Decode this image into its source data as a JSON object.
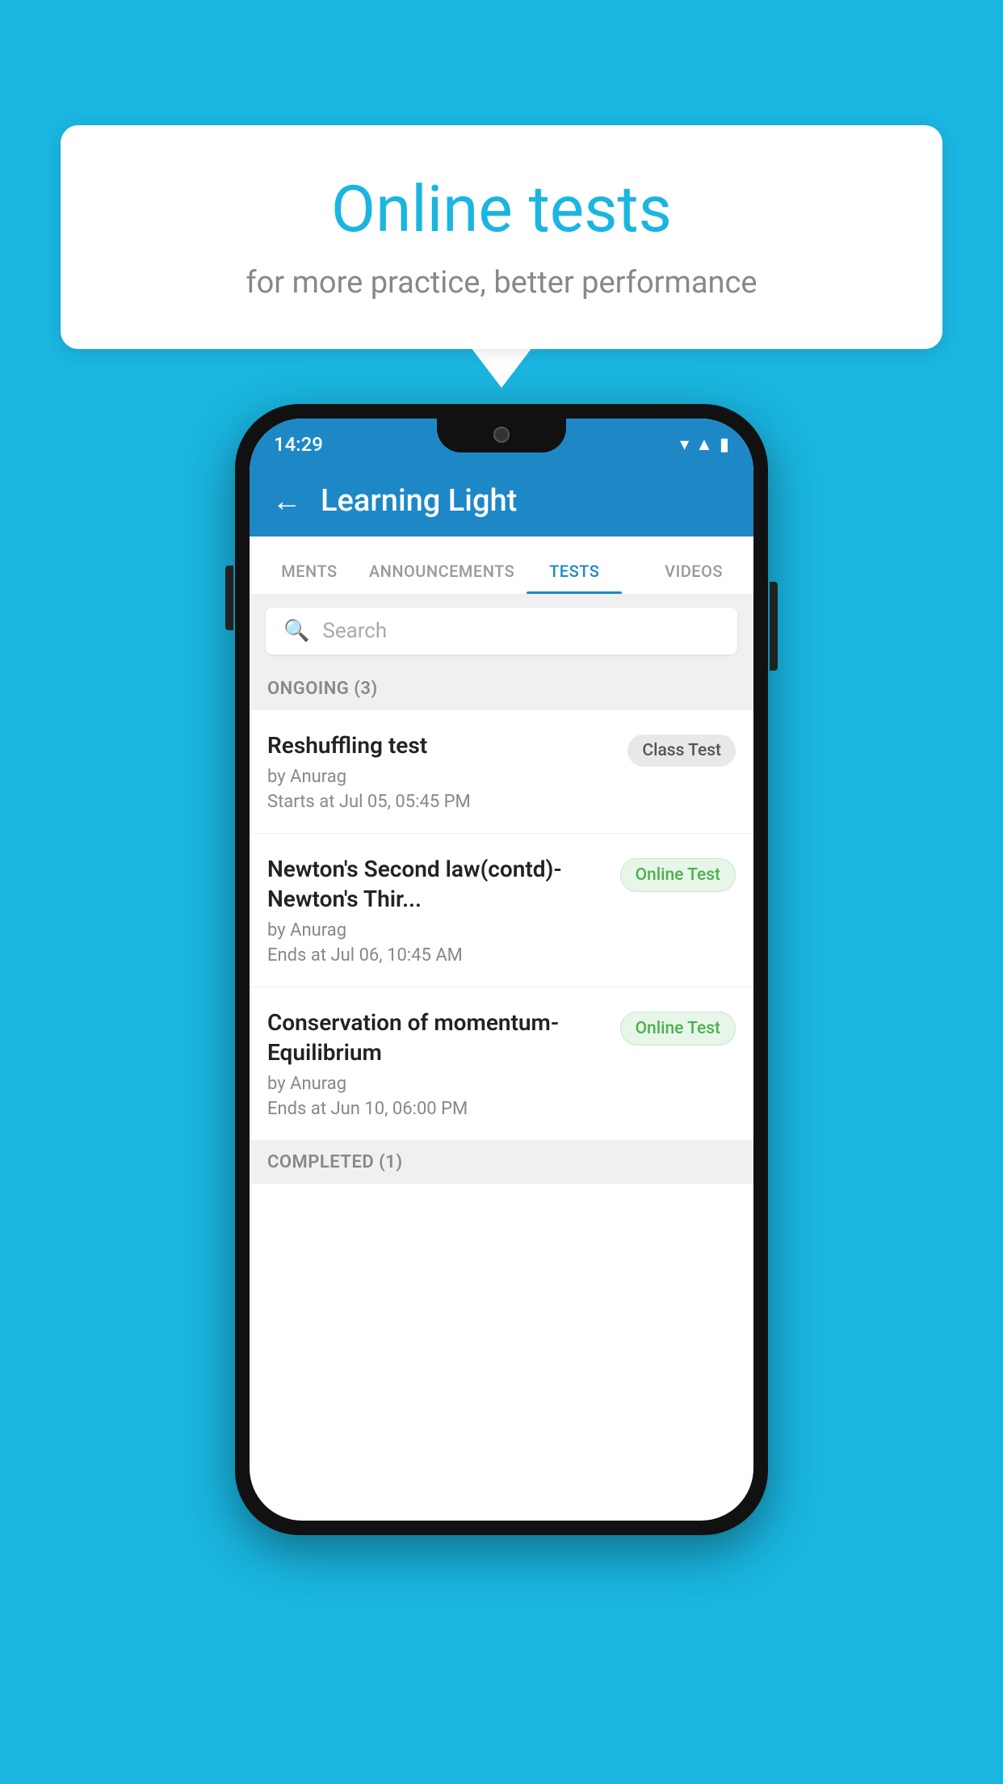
{
  "background": {
    "color": "#1ab5e0"
  },
  "speechBubble": {
    "title": "Online tests",
    "subtitle": "for more practice, better performance"
  },
  "phone": {
    "statusBar": {
      "time": "14:29",
      "icons": [
        "wifi",
        "signal",
        "battery"
      ]
    },
    "header": {
      "backLabel": "←",
      "title": "Learning Light"
    },
    "tabs": [
      {
        "label": "MENTS",
        "active": false
      },
      {
        "label": "ANNOUNCEMENTS",
        "active": false
      },
      {
        "label": "TESTS",
        "active": true
      },
      {
        "label": "VIDEOS",
        "active": false
      }
    ],
    "search": {
      "placeholder": "Search",
      "iconLabel": "🔍"
    },
    "sections": [
      {
        "title": "ONGOING (3)",
        "tests": [
          {
            "name": "Reshuffling test",
            "by": "by Anurag",
            "time": "Starts at  Jul 05, 05:45 PM",
            "badge": "Class Test",
            "badgeType": "class"
          },
          {
            "name": "Newton's Second law(contd)-Newton's Thir...",
            "by": "by Anurag",
            "time": "Ends at  Jul 06, 10:45 AM",
            "badge": "Online Test",
            "badgeType": "online"
          },
          {
            "name": "Conservation of momentum-Equilibrium",
            "by": "by Anurag",
            "time": "Ends at  Jun 10, 06:00 PM",
            "badge": "Online Test",
            "badgeType": "online"
          }
        ]
      }
    ],
    "completedSection": {
      "title": "COMPLETED (1)"
    }
  }
}
